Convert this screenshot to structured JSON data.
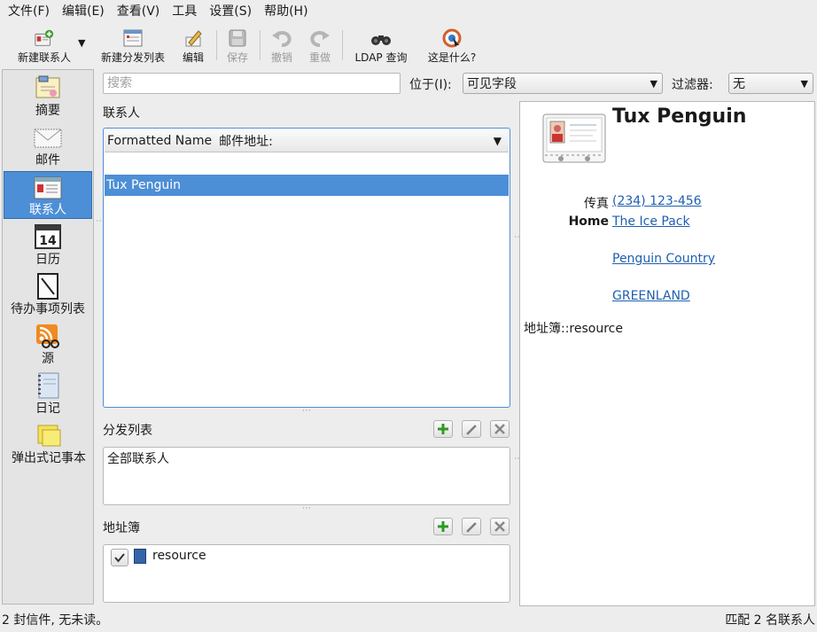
{
  "menubar": {
    "items": [
      "文件(F)",
      "编辑(E)",
      "查看(V)",
      "工具",
      "设置(S)",
      "帮助(H)"
    ]
  },
  "toolbar": {
    "new_contact": "新建联系人",
    "new_dist_list": "新建分发列表",
    "edit": "编辑",
    "save": "保存",
    "undo": "撤销",
    "redo": "重做",
    "ldap": "LDAP 查询",
    "whats_this": "这是什么?"
  },
  "sidebar": {
    "items": [
      {
        "label": "摘要",
        "icon": "summary-icon"
      },
      {
        "label": "邮件",
        "icon": "mail-icon"
      },
      {
        "label": "联系人",
        "icon": "contacts-icon",
        "active": true
      },
      {
        "label": "日历",
        "icon": "calendar-icon",
        "day": "14"
      },
      {
        "label": "待办事项列表",
        "icon": "todo-icon"
      },
      {
        "label": "源",
        "icon": "feeds-icon"
      },
      {
        "label": "日记",
        "icon": "journal-icon"
      },
      {
        "label": "弹出式记事本",
        "icon": "notes-icon"
      }
    ]
  },
  "search": {
    "placeholder": "搜索",
    "in_label": "位于(I):",
    "in_value": "可见字段",
    "filter_label": "过滤器:",
    "filter_value": "无"
  },
  "contacts": {
    "title": "联系人",
    "columns": [
      "Formatted Name",
      "邮件地址:"
    ],
    "rows": [
      {
        "name": "Tux Penguin",
        "selected": true
      }
    ]
  },
  "dist_lists": {
    "title": "分发列表",
    "items": [
      "全部联系人"
    ]
  },
  "address_books": {
    "title": "地址簿",
    "items": [
      {
        "name": "resource",
        "checked": true
      }
    ]
  },
  "detail": {
    "name": "Tux Penguin",
    "fax_label": "传真",
    "fax": "(234) 123-456",
    "home_label": "Home",
    "address_lines": [
      "The Ice Pack",
      "Penguin Country",
      "GREENLAND"
    ],
    "addressbook_line": "地址簿::resource"
  },
  "status": {
    "left": "2 封信件, 无未读。",
    "right": "匹配 2 名联系人"
  },
  "colors": {
    "accent": "#4d8fd6",
    "link": "#1f5fb0"
  }
}
